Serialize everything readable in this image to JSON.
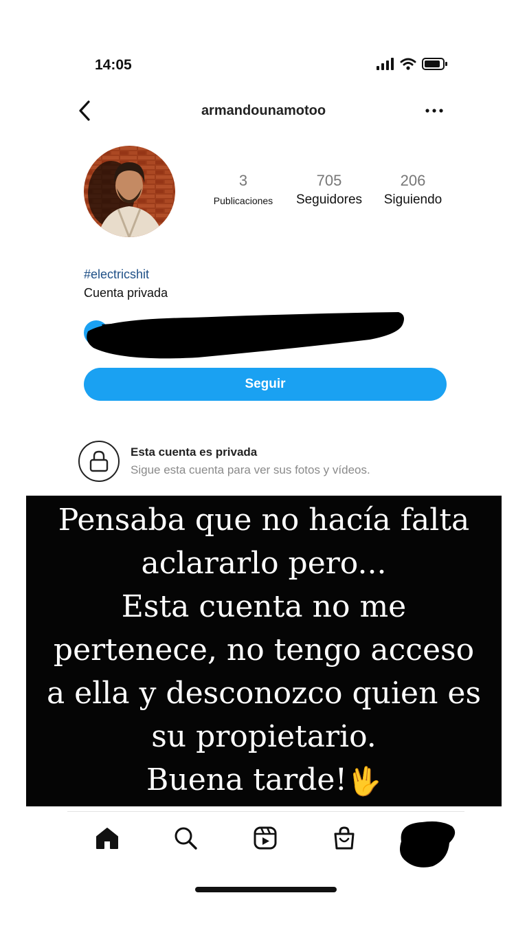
{
  "status_bar": {
    "time": "14:05",
    "icons": [
      "signal-icon",
      "wifi-icon",
      "battery-icon"
    ]
  },
  "header": {
    "username": "armandounamotoo",
    "back_icon": "chevron-left-icon",
    "more_icon": "more-horizontal-icon"
  },
  "profile": {
    "stats": {
      "posts_count": "3",
      "posts_label": "Publicaciones",
      "followers_count": "705",
      "followers_label": "Seguidores",
      "following_count": "206",
      "following_label": "Siguiendo"
    },
    "bio_hashtag": "#electricshit",
    "privacy_label": "Cuenta privada"
  },
  "follow_button": {
    "label": "Seguir",
    "color": "#1aa1f2"
  },
  "private_notice": {
    "title": "Esta cuenta es privada",
    "subtitle": "Sigue esta cuenta para ver sus fotos y vídeos.",
    "icon": "lock-icon"
  },
  "overlay_message": {
    "lines": [
      "Pensaba que no hacía falta",
      "aclararlo pero...",
      "Esta cuenta no me",
      "pertenece, no tengo acceso",
      "a ella y desconozco quien es",
      "su propietario.",
      "Buena tarde!"
    ],
    "emoji": "🖖"
  },
  "tab_bar": {
    "tabs": [
      "home-icon",
      "search-icon",
      "reels-icon",
      "shop-icon",
      "profile-tab"
    ]
  },
  "colors": {
    "accent": "#1aa1f2",
    "hashtag": "#1e4f86",
    "overlay_bg": "#050505"
  }
}
